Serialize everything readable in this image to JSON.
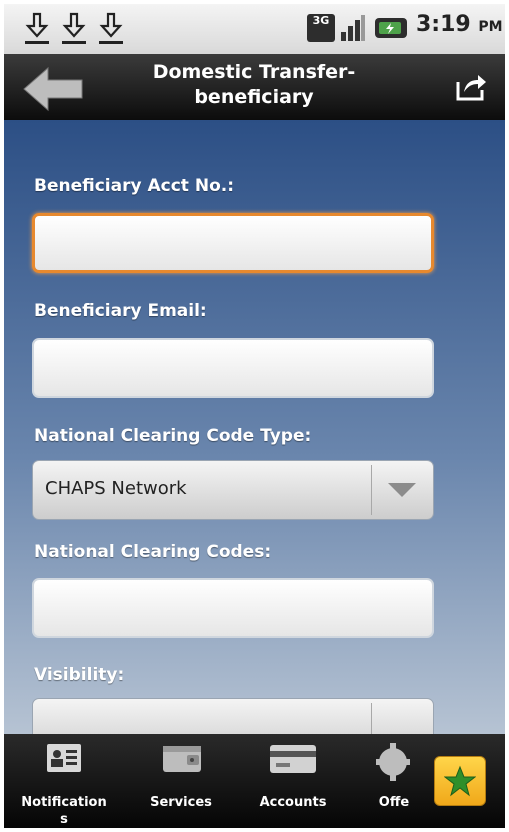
{
  "status_bar": {
    "network": "3G",
    "time": "3:19",
    "time_suffix": "PM"
  },
  "header": {
    "title_line1": "Domestic Transfer-",
    "title_line2": "beneficiary"
  },
  "form": {
    "acct_label": "Beneficiary Acct No.:",
    "acct_value": "",
    "email_label": "Beneficiary Email:",
    "email_value": "",
    "code_type_label": "National Clearing Code Type:",
    "code_type_selected": "CHAPS Network",
    "codes_label": "National Clearing Codes:",
    "codes_value": "",
    "visibility_label": "Visibility:"
  },
  "bottom_nav": {
    "notifications_line1": "Notification",
    "notifications_line2": "s",
    "services": "Services",
    "accounts": "Accounts",
    "offers": "Offe"
  },
  "colors": {
    "accent_focus": "#e7892e",
    "content_gradient_top": "#2c4f85",
    "favorite": "#f0a81a"
  },
  "icons": [
    "download-icon",
    "signal-icon",
    "battery-icon",
    "back-arrow-icon",
    "share-icon",
    "contact-card-icon",
    "wallet-icon",
    "credit-card-icon",
    "gear-icon",
    "star-icon"
  ]
}
